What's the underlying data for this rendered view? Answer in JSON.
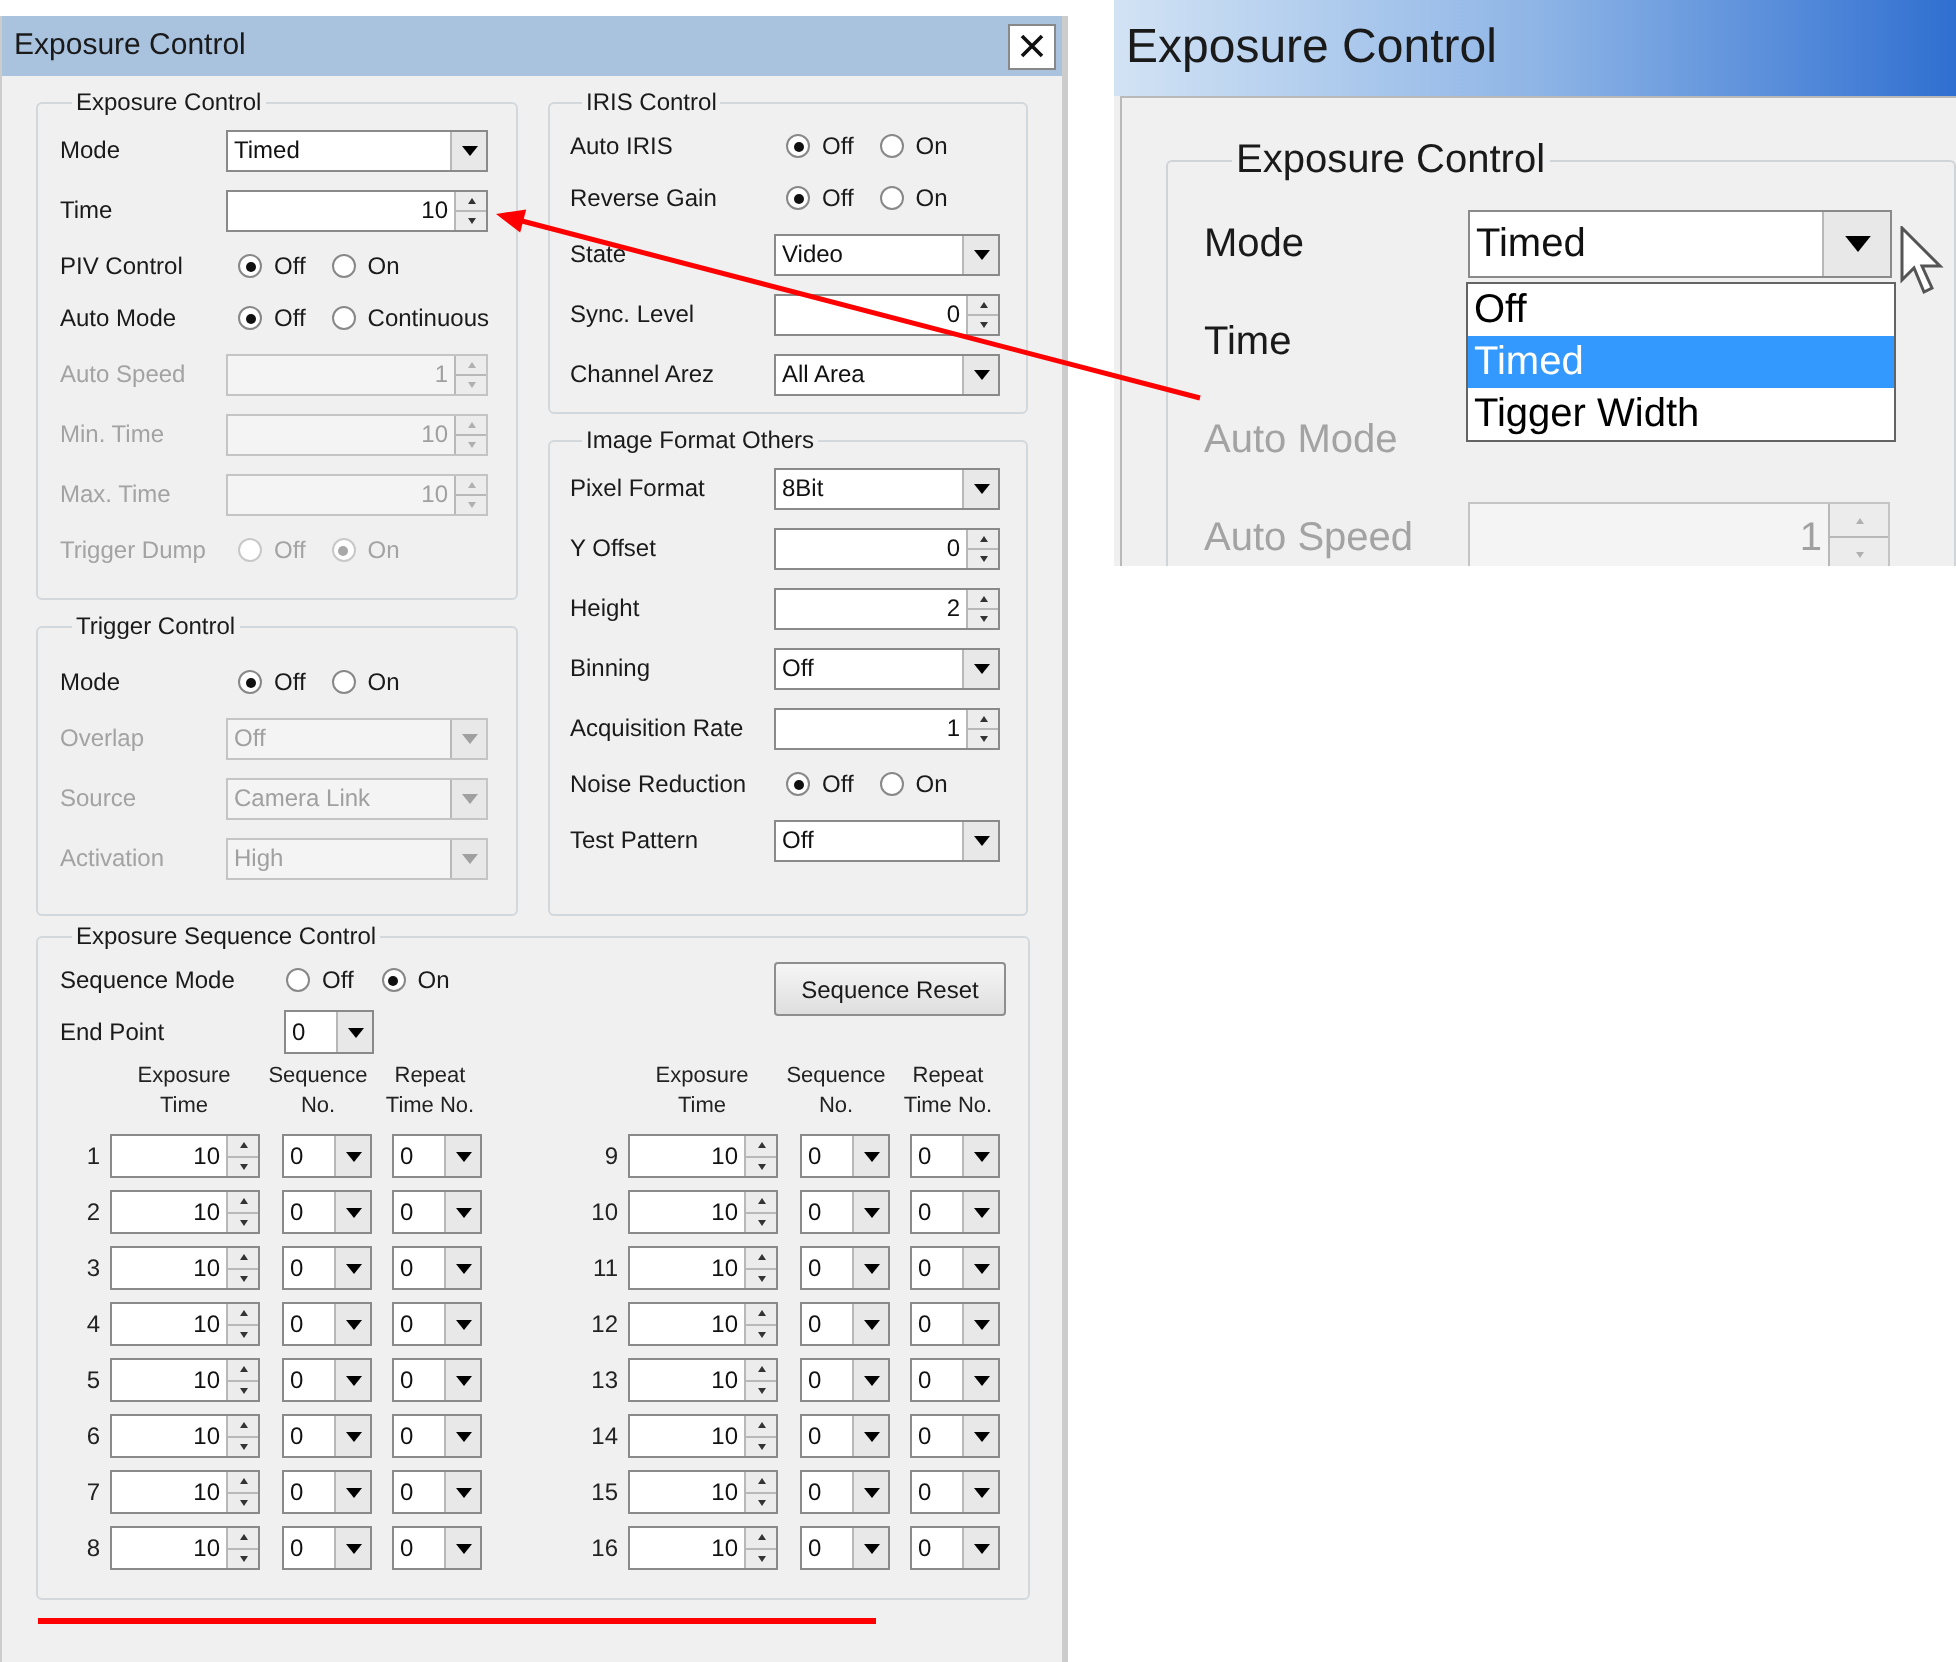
{
  "dialog": {
    "title": "Exposure Control",
    "exposure_control": {
      "title": "Exposure Control",
      "rows": [
        {
          "kind": "select",
          "label": "Mode",
          "value": "Timed",
          "disabled": false
        },
        {
          "kind": "spin",
          "label": "Time",
          "value": "10",
          "disabled": false
        },
        {
          "kind": "radio",
          "label": "PIV Control",
          "disabled": false,
          "options": [
            {
              "label": "Off",
              "selected": true
            },
            {
              "label": "On",
              "selected": false
            }
          ]
        },
        {
          "kind": "radio",
          "label": "Auto Mode",
          "disabled": false,
          "options": [
            {
              "label": "Off",
              "selected": true
            },
            {
              "label": "Continuous",
              "selected": false
            }
          ]
        },
        {
          "kind": "spin",
          "label": "Auto Speed",
          "value": "1",
          "disabled": true
        },
        {
          "kind": "spin",
          "label": "Min. Time",
          "value": "10",
          "disabled": true
        },
        {
          "kind": "spin",
          "label": "Max. Time",
          "value": "10",
          "disabled": true
        },
        {
          "kind": "radio",
          "label": "Trigger Dump",
          "disabled": true,
          "options": [
            {
              "label": "Off",
              "selected": false
            },
            {
              "label": "On",
              "selected": true
            }
          ]
        }
      ]
    },
    "trigger_control": {
      "title": "Trigger Control",
      "rows": [
        {
          "kind": "radio",
          "label": "Mode",
          "disabled": false,
          "options": [
            {
              "label": "Off",
              "selected": true
            },
            {
              "label": "On",
              "selected": false
            }
          ]
        },
        {
          "kind": "select",
          "label": "Overlap",
          "value": "Off",
          "disabled": true
        },
        {
          "kind": "select",
          "label": "Source",
          "value": "Camera Link",
          "disabled": true
        },
        {
          "kind": "select",
          "label": "Activation",
          "value": "High",
          "disabled": true
        }
      ]
    },
    "iris_control": {
      "title": "IRIS Control",
      "rows": [
        {
          "kind": "radio",
          "label": "Auto IRIS",
          "disabled": false,
          "options": [
            {
              "label": "Off",
              "selected": true
            },
            {
              "label": "On",
              "selected": false
            }
          ]
        },
        {
          "kind": "radio",
          "label": "Reverse Gain",
          "disabled": false,
          "options": [
            {
              "label": "Off",
              "selected": true
            },
            {
              "label": "On",
              "selected": false
            }
          ]
        },
        {
          "kind": "select",
          "label": "State",
          "value": "Video",
          "disabled": false
        },
        {
          "kind": "spin",
          "label": "Sync. Level",
          "value": "0",
          "disabled": false
        },
        {
          "kind": "select",
          "label": "Channel Arez",
          "value": "All Area",
          "disabled": false
        }
      ]
    },
    "image_format": {
      "title": "Image Format Others",
      "rows": [
        {
          "kind": "select",
          "label": "Pixel Format",
          "value": "8Bit",
          "disabled": false
        },
        {
          "kind": "spin",
          "label": "Y Offset",
          "value": "0",
          "disabled": false
        },
        {
          "kind": "spin",
          "label": "Height",
          "value": "2",
          "disabled": false
        },
        {
          "kind": "select",
          "label": "Binning",
          "value": "Off",
          "disabled": false
        },
        {
          "kind": "spin",
          "label": "Acquisition Rate",
          "value": "1",
          "disabled": false
        },
        {
          "kind": "radio",
          "label": "Noise Reduction",
          "disabled": false,
          "options": [
            {
              "label": "Off",
              "selected": true
            },
            {
              "label": "On",
              "selected": false
            }
          ]
        },
        {
          "kind": "select",
          "label": "Test Pattern",
          "value": "Off",
          "disabled": false
        }
      ]
    },
    "sequence": {
      "title": "Exposure Sequence Control",
      "mode": {
        "label": "Sequence Mode",
        "options": [
          {
            "label": "Off",
            "selected": false
          },
          {
            "label": "On",
            "selected": true
          }
        ]
      },
      "end_point": {
        "label": "End Point",
        "value": "0"
      },
      "reset_button": "Sequence Reset",
      "groups": [
        {
          "columns": [
            "Exposure Time",
            "Sequence No.",
            "Repeat Time No."
          ],
          "rows": [
            {
              "index": "1",
              "exposure_time": "10",
              "sequence_no": "0",
              "repeat_time_no": "0"
            },
            {
              "index": "2",
              "exposure_time": "10",
              "sequence_no": "0",
              "repeat_time_no": "0"
            },
            {
              "index": "3",
              "exposure_time": "10",
              "sequence_no": "0",
              "repeat_time_no": "0"
            },
            {
              "index": "4",
              "exposure_time": "10",
              "sequence_no": "0",
              "repeat_time_no": "0"
            },
            {
              "index": "5",
              "exposure_time": "10",
              "sequence_no": "0",
              "repeat_time_no": "0"
            },
            {
              "index": "6",
              "exposure_time": "10",
              "sequence_no": "0",
              "repeat_time_no": "0"
            },
            {
              "index": "7",
              "exposure_time": "10",
              "sequence_no": "0",
              "repeat_time_no": "0"
            },
            {
              "index": "8",
              "exposure_time": "10",
              "sequence_no": "0",
              "repeat_time_no": "0"
            }
          ]
        },
        {
          "columns": [
            "Exposure Time",
            "Sequence No.",
            "Repeat Time No."
          ],
          "rows": [
            {
              "index": "9",
              "exposure_time": "10",
              "sequence_no": "0",
              "repeat_time_no": "0"
            },
            {
              "index": "10",
              "exposure_time": "10",
              "sequence_no": "0",
              "repeat_time_no": "0"
            },
            {
              "index": "11",
              "exposure_time": "10",
              "sequence_no": "0",
              "repeat_time_no": "0"
            },
            {
              "index": "12",
              "exposure_time": "10",
              "sequence_no": "0",
              "repeat_time_no": "0"
            },
            {
              "index": "13",
              "exposure_time": "10",
              "sequence_no": "0",
              "repeat_time_no": "0"
            },
            {
              "index": "14",
              "exposure_time": "10",
              "sequence_no": "0",
              "repeat_time_no": "0"
            },
            {
              "index": "15",
              "exposure_time": "10",
              "sequence_no": "0",
              "repeat_time_no": "0"
            },
            {
              "index": "16",
              "exposure_time": "10",
              "sequence_no": "0",
              "repeat_time_no": "0"
            }
          ]
        }
      ]
    }
  },
  "inset": {
    "title": "Exposure Control",
    "group_title": "Exposure Control",
    "rows": [
      {
        "kind": "select",
        "label": "Mode",
        "value": "Timed",
        "disabled": false,
        "open": true,
        "options": [
          {
            "label": "Off",
            "selected": false
          },
          {
            "label": "Timed",
            "selected": true
          },
          {
            "label": "Tigger Width",
            "selected": false
          }
        ]
      },
      {
        "kind": "label",
        "label": "Time",
        "disabled": false
      },
      {
        "kind": "label",
        "label": "Auto Mode",
        "disabled": true
      },
      {
        "kind": "spin",
        "label": "Auto Speed",
        "value": "1",
        "disabled": true
      }
    ]
  }
}
